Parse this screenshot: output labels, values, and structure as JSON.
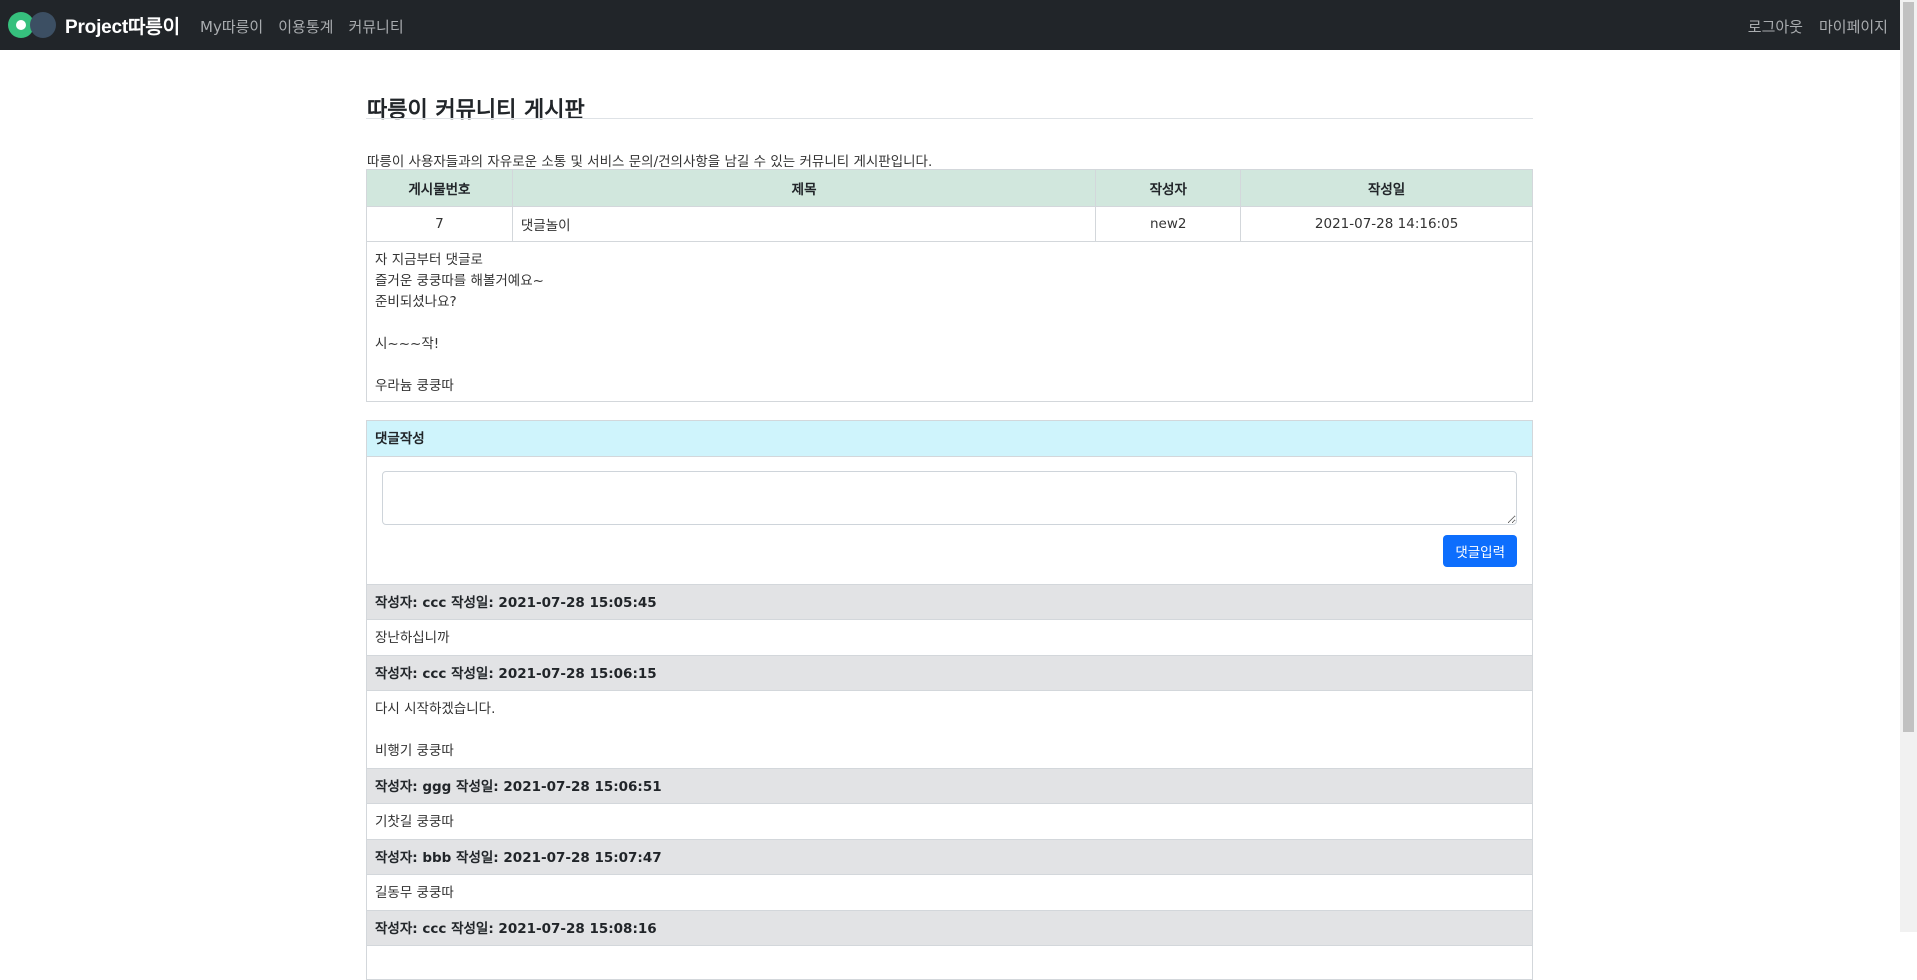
{
  "nav": {
    "brand": "Project따릉이",
    "left_links": [
      "My따릉이",
      "이용통계",
      "커뮤니티"
    ],
    "right_links": [
      "로그아웃",
      "마이페이지"
    ]
  },
  "page": {
    "title": "따릉이 커뮤니티 게시판",
    "description": "따릉이 사용자들과의 자유로운 소통 및 서비스 문의/건의사항을 남길 수 있는 커뮤니티 게시판입니다."
  },
  "post_table": {
    "headers": [
      "게시물번호",
      "제목",
      "작성자",
      "작성일"
    ],
    "row": [
      "7",
      "댓글놀이",
      "new2",
      "2021-07-28 14:16:05"
    ],
    "body_lines": [
      "자 지금부터 댓글로",
      "즐거운 쿵쿵따를 해볼거예요~",
      "준비되셨나요?",
      "",
      "시~~~작!",
      "",
      "우라늄 쿵쿵따"
    ]
  },
  "comment_form": {
    "header": "댓글작성",
    "textarea_value": "",
    "submit_label": "댓글입력"
  },
  "comments": [
    {
      "header": "작성자: ccc 작성일: 2021-07-28 15:05:45",
      "lines": [
        "장난하십니까"
      ]
    },
    {
      "header": "작성자: ccc 작성일: 2021-07-28 15:06:15",
      "lines": [
        "다시 시작하겠습니다.",
        "",
        "비행기 쿵쿵따"
      ]
    },
    {
      "header": "작성자: ggg 작성일: 2021-07-28 15:06:51",
      "lines": [
        "기찻길 쿵쿵따"
      ]
    },
    {
      "header": "작성자: bbb 작성일: 2021-07-28 15:07:47",
      "lines": [
        "길동무 쿵쿵따"
      ]
    },
    {
      "header": "작성자: ccc 작성일: 2021-07-28 15:08:16",
      "lines": []
    }
  ]
}
